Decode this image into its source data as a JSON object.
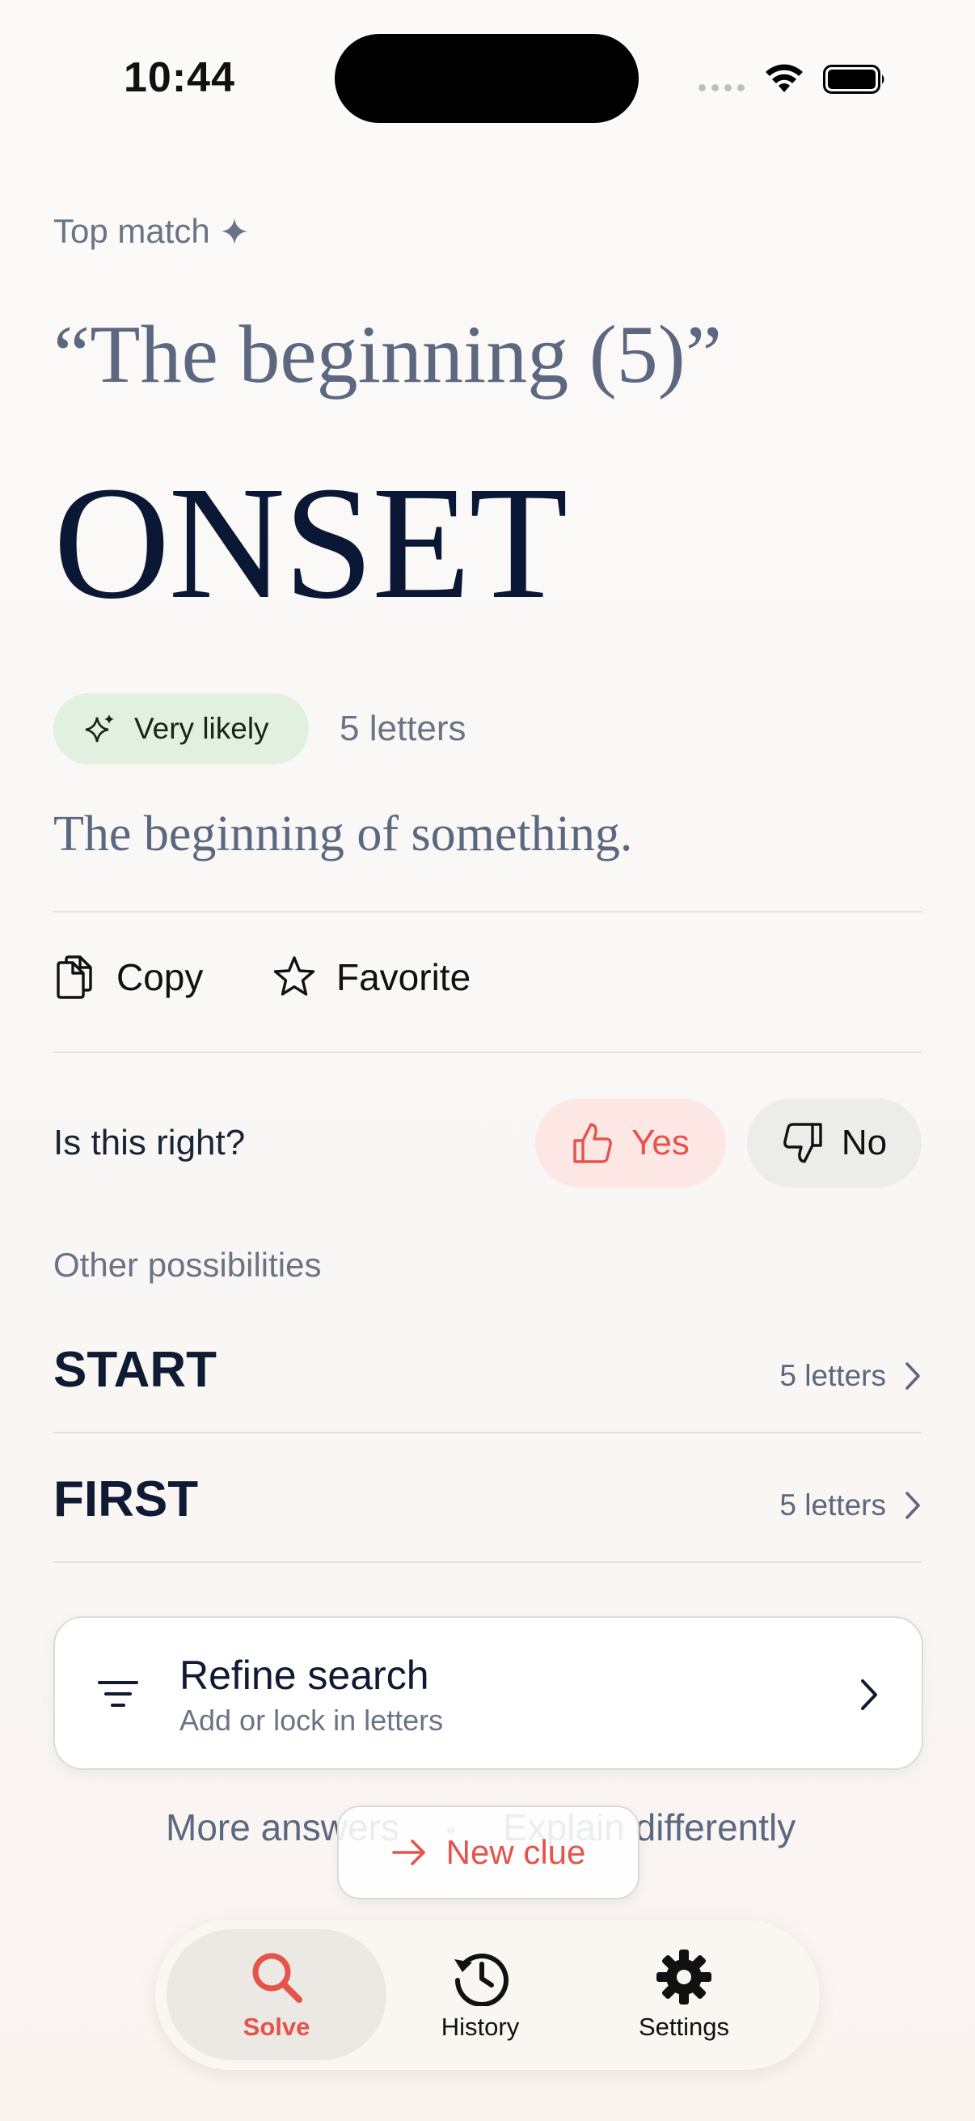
{
  "status": {
    "time": "10:44"
  },
  "header": {
    "top_match_label": "Top match",
    "clue": "“The beginning (5)”"
  },
  "result": {
    "answer": "ONSET",
    "confidence_badge": "Very likely",
    "letters": "5 letters",
    "definition": "The beginning of something."
  },
  "actions": {
    "copy": "Copy",
    "favorite": "Favorite"
  },
  "feedback": {
    "question": "Is this right?",
    "yes": "Yes",
    "no": "No"
  },
  "alternatives": {
    "label": "Other possibilities",
    "items": [
      {
        "word": "START",
        "meta": "5 letters"
      },
      {
        "word": "FIRST",
        "meta": "5 letters"
      }
    ]
  },
  "refine": {
    "title": "Refine search",
    "subtitle": "Add or lock in letters"
  },
  "bottom_links": {
    "more": "More answers",
    "explain": "Explain differently"
  },
  "new_clue": "New clue",
  "tabs": [
    {
      "label": "Solve",
      "icon": "search-icon",
      "active": true
    },
    {
      "label": "History",
      "icon": "history-icon",
      "active": false
    },
    {
      "label": "Settings",
      "icon": "gear-icon",
      "active": false
    }
  ],
  "colors": {
    "accent": "#e5534b",
    "ink": "#0f1a33",
    "muted": "#5b6880",
    "badge_bg": "#e2f0df"
  }
}
